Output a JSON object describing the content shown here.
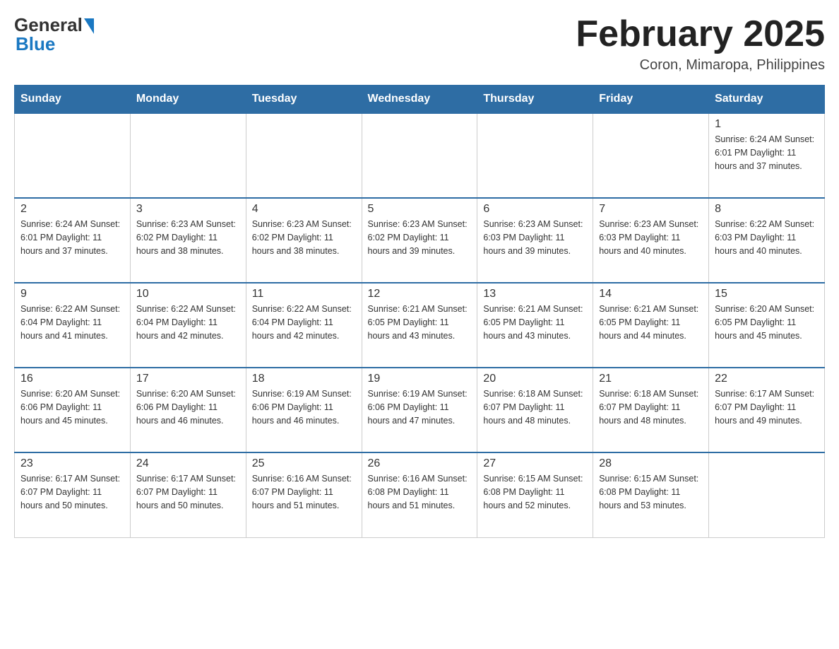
{
  "header": {
    "logo_general": "General",
    "logo_blue": "Blue",
    "month_title": "February 2025",
    "location": "Coron, Mimaropa, Philippines"
  },
  "days_of_week": [
    "Sunday",
    "Monday",
    "Tuesday",
    "Wednesday",
    "Thursday",
    "Friday",
    "Saturday"
  ],
  "weeks": [
    [
      {
        "day": "",
        "info": ""
      },
      {
        "day": "",
        "info": ""
      },
      {
        "day": "",
        "info": ""
      },
      {
        "day": "",
        "info": ""
      },
      {
        "day": "",
        "info": ""
      },
      {
        "day": "",
        "info": ""
      },
      {
        "day": "1",
        "info": "Sunrise: 6:24 AM\nSunset: 6:01 PM\nDaylight: 11 hours and 37 minutes."
      }
    ],
    [
      {
        "day": "2",
        "info": "Sunrise: 6:24 AM\nSunset: 6:01 PM\nDaylight: 11 hours and 37 minutes."
      },
      {
        "day": "3",
        "info": "Sunrise: 6:23 AM\nSunset: 6:02 PM\nDaylight: 11 hours and 38 minutes."
      },
      {
        "day": "4",
        "info": "Sunrise: 6:23 AM\nSunset: 6:02 PM\nDaylight: 11 hours and 38 minutes."
      },
      {
        "day": "5",
        "info": "Sunrise: 6:23 AM\nSunset: 6:02 PM\nDaylight: 11 hours and 39 minutes."
      },
      {
        "day": "6",
        "info": "Sunrise: 6:23 AM\nSunset: 6:03 PM\nDaylight: 11 hours and 39 minutes."
      },
      {
        "day": "7",
        "info": "Sunrise: 6:23 AM\nSunset: 6:03 PM\nDaylight: 11 hours and 40 minutes."
      },
      {
        "day": "8",
        "info": "Sunrise: 6:22 AM\nSunset: 6:03 PM\nDaylight: 11 hours and 40 minutes."
      }
    ],
    [
      {
        "day": "9",
        "info": "Sunrise: 6:22 AM\nSunset: 6:04 PM\nDaylight: 11 hours and 41 minutes."
      },
      {
        "day": "10",
        "info": "Sunrise: 6:22 AM\nSunset: 6:04 PM\nDaylight: 11 hours and 42 minutes."
      },
      {
        "day": "11",
        "info": "Sunrise: 6:22 AM\nSunset: 6:04 PM\nDaylight: 11 hours and 42 minutes."
      },
      {
        "day": "12",
        "info": "Sunrise: 6:21 AM\nSunset: 6:05 PM\nDaylight: 11 hours and 43 minutes."
      },
      {
        "day": "13",
        "info": "Sunrise: 6:21 AM\nSunset: 6:05 PM\nDaylight: 11 hours and 43 minutes."
      },
      {
        "day": "14",
        "info": "Sunrise: 6:21 AM\nSunset: 6:05 PM\nDaylight: 11 hours and 44 minutes."
      },
      {
        "day": "15",
        "info": "Sunrise: 6:20 AM\nSunset: 6:05 PM\nDaylight: 11 hours and 45 minutes."
      }
    ],
    [
      {
        "day": "16",
        "info": "Sunrise: 6:20 AM\nSunset: 6:06 PM\nDaylight: 11 hours and 45 minutes."
      },
      {
        "day": "17",
        "info": "Sunrise: 6:20 AM\nSunset: 6:06 PM\nDaylight: 11 hours and 46 minutes."
      },
      {
        "day": "18",
        "info": "Sunrise: 6:19 AM\nSunset: 6:06 PM\nDaylight: 11 hours and 46 minutes."
      },
      {
        "day": "19",
        "info": "Sunrise: 6:19 AM\nSunset: 6:06 PM\nDaylight: 11 hours and 47 minutes."
      },
      {
        "day": "20",
        "info": "Sunrise: 6:18 AM\nSunset: 6:07 PM\nDaylight: 11 hours and 48 minutes."
      },
      {
        "day": "21",
        "info": "Sunrise: 6:18 AM\nSunset: 6:07 PM\nDaylight: 11 hours and 48 minutes."
      },
      {
        "day": "22",
        "info": "Sunrise: 6:17 AM\nSunset: 6:07 PM\nDaylight: 11 hours and 49 minutes."
      }
    ],
    [
      {
        "day": "23",
        "info": "Sunrise: 6:17 AM\nSunset: 6:07 PM\nDaylight: 11 hours and 50 minutes."
      },
      {
        "day": "24",
        "info": "Sunrise: 6:17 AM\nSunset: 6:07 PM\nDaylight: 11 hours and 50 minutes."
      },
      {
        "day": "25",
        "info": "Sunrise: 6:16 AM\nSunset: 6:07 PM\nDaylight: 11 hours and 51 minutes."
      },
      {
        "day": "26",
        "info": "Sunrise: 6:16 AM\nSunset: 6:08 PM\nDaylight: 11 hours and 51 minutes."
      },
      {
        "day": "27",
        "info": "Sunrise: 6:15 AM\nSunset: 6:08 PM\nDaylight: 11 hours and 52 minutes."
      },
      {
        "day": "28",
        "info": "Sunrise: 6:15 AM\nSunset: 6:08 PM\nDaylight: 11 hours and 53 minutes."
      },
      {
        "day": "",
        "info": ""
      }
    ]
  ]
}
